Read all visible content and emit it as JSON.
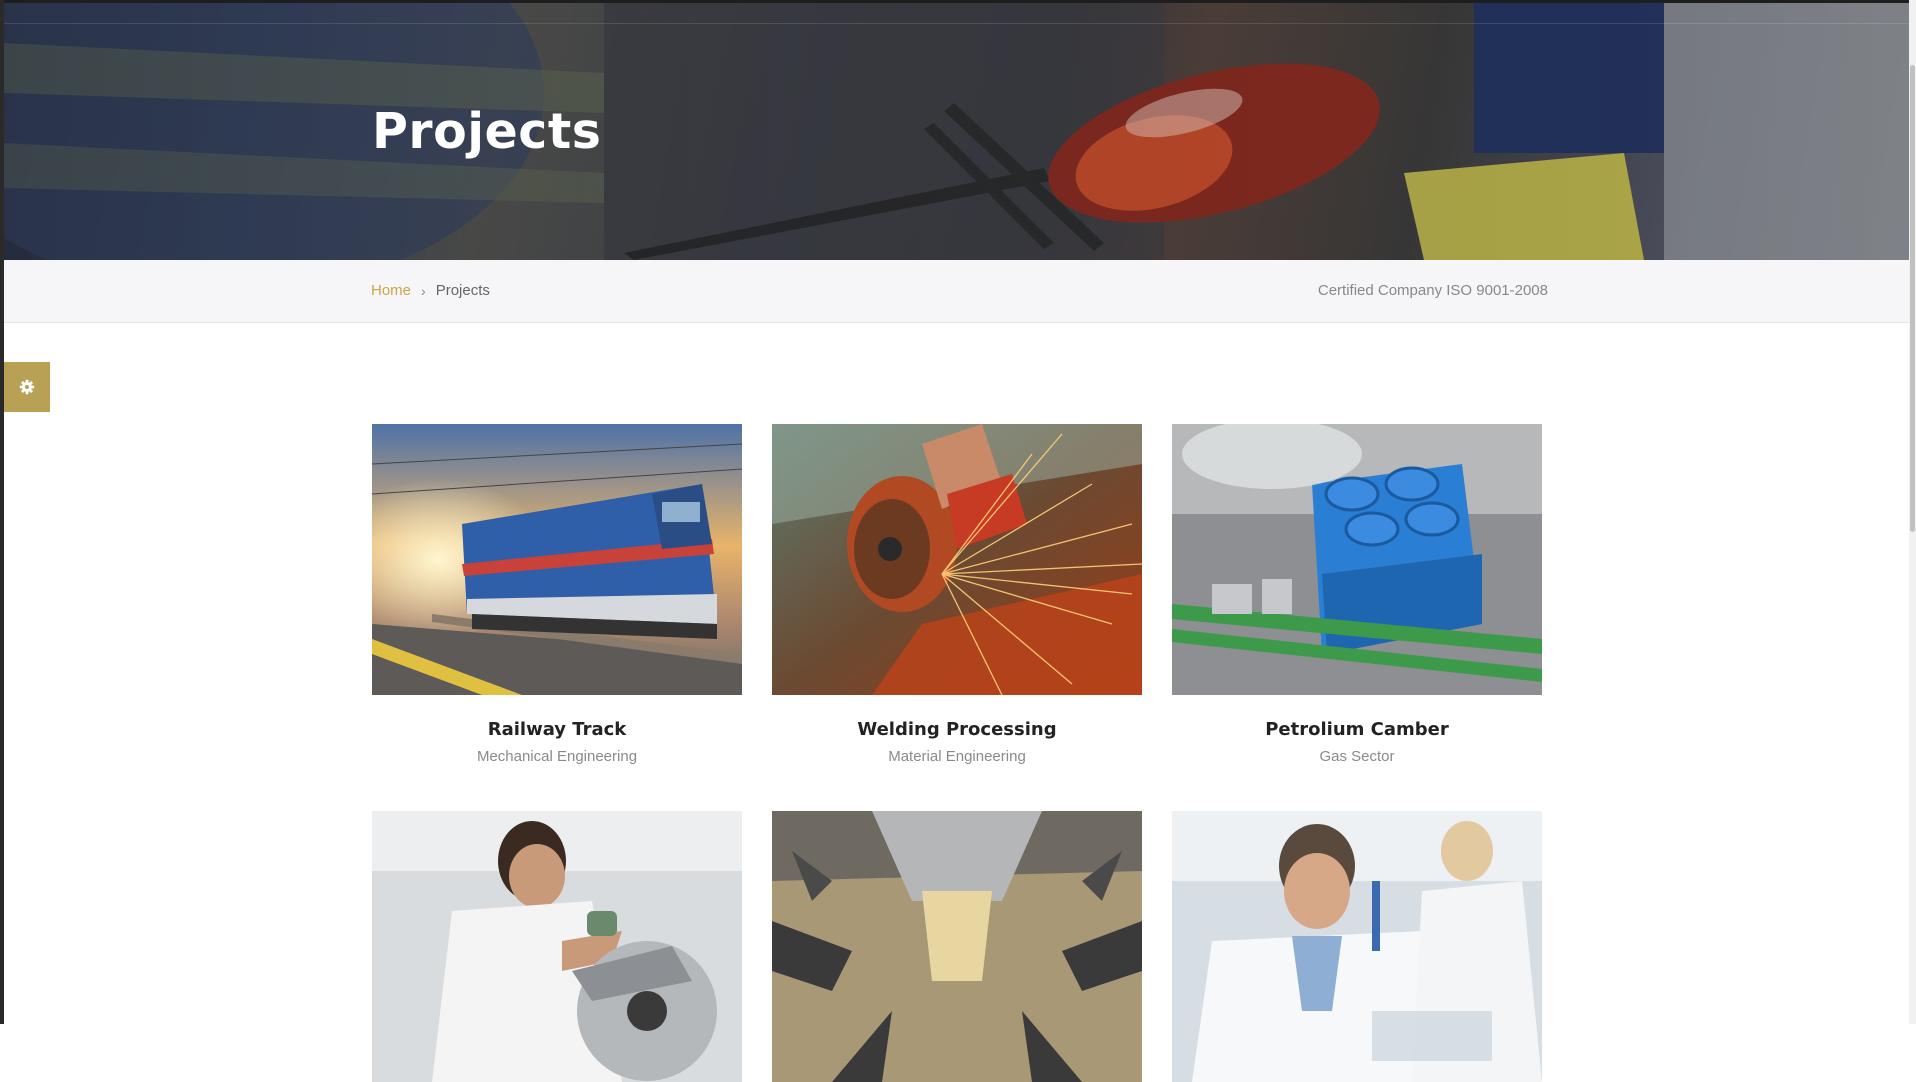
{
  "hero": {
    "title": "Projects"
  },
  "breadcrumb": {
    "home_label": "Home",
    "separator": "›",
    "current_label": "Projects"
  },
  "certification": "Certified Company ISO 9001-2008",
  "settings": {
    "icon": "gear-icon",
    "color": "#b8a155"
  },
  "colors": {
    "accent": "#c8a844",
    "breadcrumb_bg": "#f6f6f9"
  },
  "projects": [
    {
      "title": "Railway Track",
      "category": "Mechanical Engineering",
      "image": "electric-locomotive-at-station"
    },
    {
      "title": "Welding Processing",
      "category": "Material Engineering",
      "image": "angle-grinder-sparks"
    },
    {
      "title": "Petrolium Camber",
      "category": "Gas Sector",
      "image": "industrial-cooling-tower-plant"
    },
    {
      "title": "",
      "category": "",
      "image": "worker-with-circular-saw"
    },
    {
      "title": "",
      "category": "",
      "image": "food-processing-machine"
    },
    {
      "title": "",
      "category": "",
      "image": "laboratory-scientists"
    }
  ]
}
